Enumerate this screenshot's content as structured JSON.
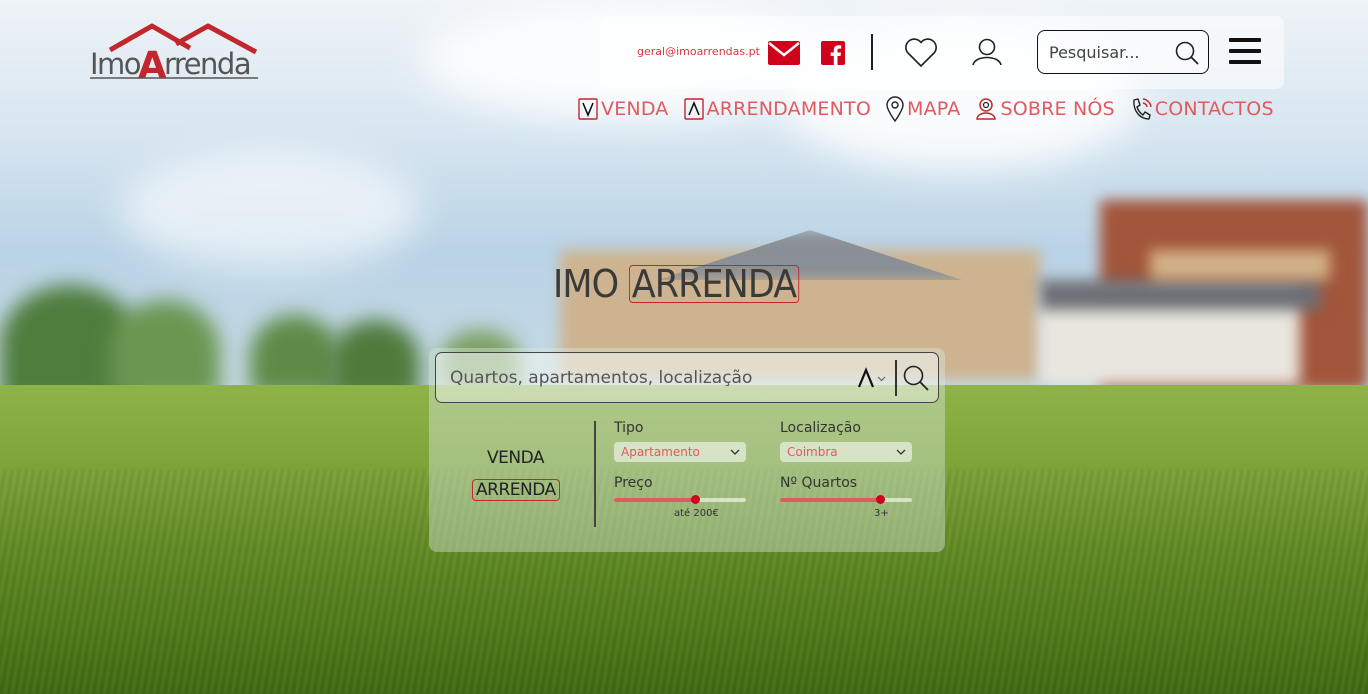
{
  "brand": {
    "name": "ImoArrenda",
    "logo_part1": "Imo",
    "logo_part2": "Arrenda",
    "hero_part1": "IMO",
    "hero_part2": "ARRENDA",
    "color": "#c1272d"
  },
  "header": {
    "email": "geral@imoarrendas.pt",
    "search_placeholder": "Pesquisar...",
    "icons": [
      "mail-icon",
      "facebook-icon",
      "heart-icon",
      "user-icon",
      "search-icon",
      "menu-icon"
    ]
  },
  "nav": {
    "items": [
      {
        "label": "VENDA",
        "icon": "venda-icon"
      },
      {
        "label": "ARRENDAMENTO",
        "icon": "arrendamento-icon"
      },
      {
        "label": "MAPA",
        "icon": "map-pin-icon"
      },
      {
        "label": "SOBRE NÓS",
        "icon": "people-icon"
      },
      {
        "label": "CONTACTOS",
        "icon": "phone-icon"
      }
    ],
    "color": "#e05a5f"
  },
  "search": {
    "placeholder": "Quartos, apartamentos, localização",
    "mode_venda": "VENDA",
    "mode_arrenda": "ARRENDA",
    "active_mode": "ARRENDA",
    "filters": {
      "tipo_label": "Tipo",
      "tipo_value": "Apartamento",
      "localizacao_label": "Localização",
      "localizacao_value": "Coimbra",
      "preco_label": "Preço",
      "preco_value_text": "até 200€",
      "preco_fraction": 0.61,
      "quartos_label": "Nº Quartos",
      "quartos_value_text": "3+",
      "quartos_fraction": 0.76
    }
  }
}
